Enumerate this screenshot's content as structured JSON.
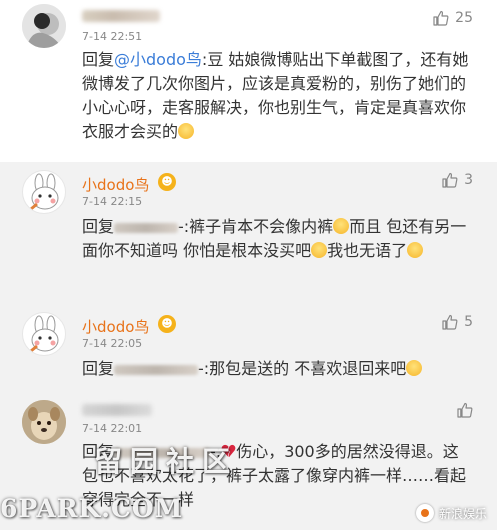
{
  "comments": [
    {
      "time": "7-14 22:51",
      "likes": "25",
      "reply_prefix": "回复",
      "mention": "@小dodo鸟",
      "text": ":豆 姑娘微博贴出下单截图了，还有她微博发了几次你图片，应该是真爱粉的，别伤了她们的小心心呀，走客服解决，你也别生气，肯定是真喜欢你衣服才会买的"
    },
    {
      "username": "小dodo鸟",
      "time": "7-14 22:15",
      "likes": "3",
      "reply_prefix": "回复",
      "text_a": "-:裤子肯本不会像内裤",
      "text_b": "而且 包还有另一面你不知道吗 你怕是根本没买吧",
      "text_c": "我也无语了"
    },
    {
      "username": "小dodo鸟",
      "time": "7-14 22:05",
      "likes": "5",
      "reply_prefix": "回复",
      "text_a": "-:那包是送的 不喜欢退回来吧"
    },
    {
      "time": "7-14 22:01",
      "reply_prefix": "回复",
      "text_a": "-:",
      "text_b": "伤心，300多的居然没得",
      "text_c": "退。这包也不喜欢太花了，裤子太露了像穿内裤一样……看起穿得完全不一样"
    }
  ],
  "watermark": {
    "cn": "留园社区",
    "en": "6PARK.COM",
    "brand": "新浪娱乐"
  },
  "colors": {
    "username": "#e8731a",
    "mention": "#3b7dd8",
    "reply_bg": "#f2f2f2"
  }
}
